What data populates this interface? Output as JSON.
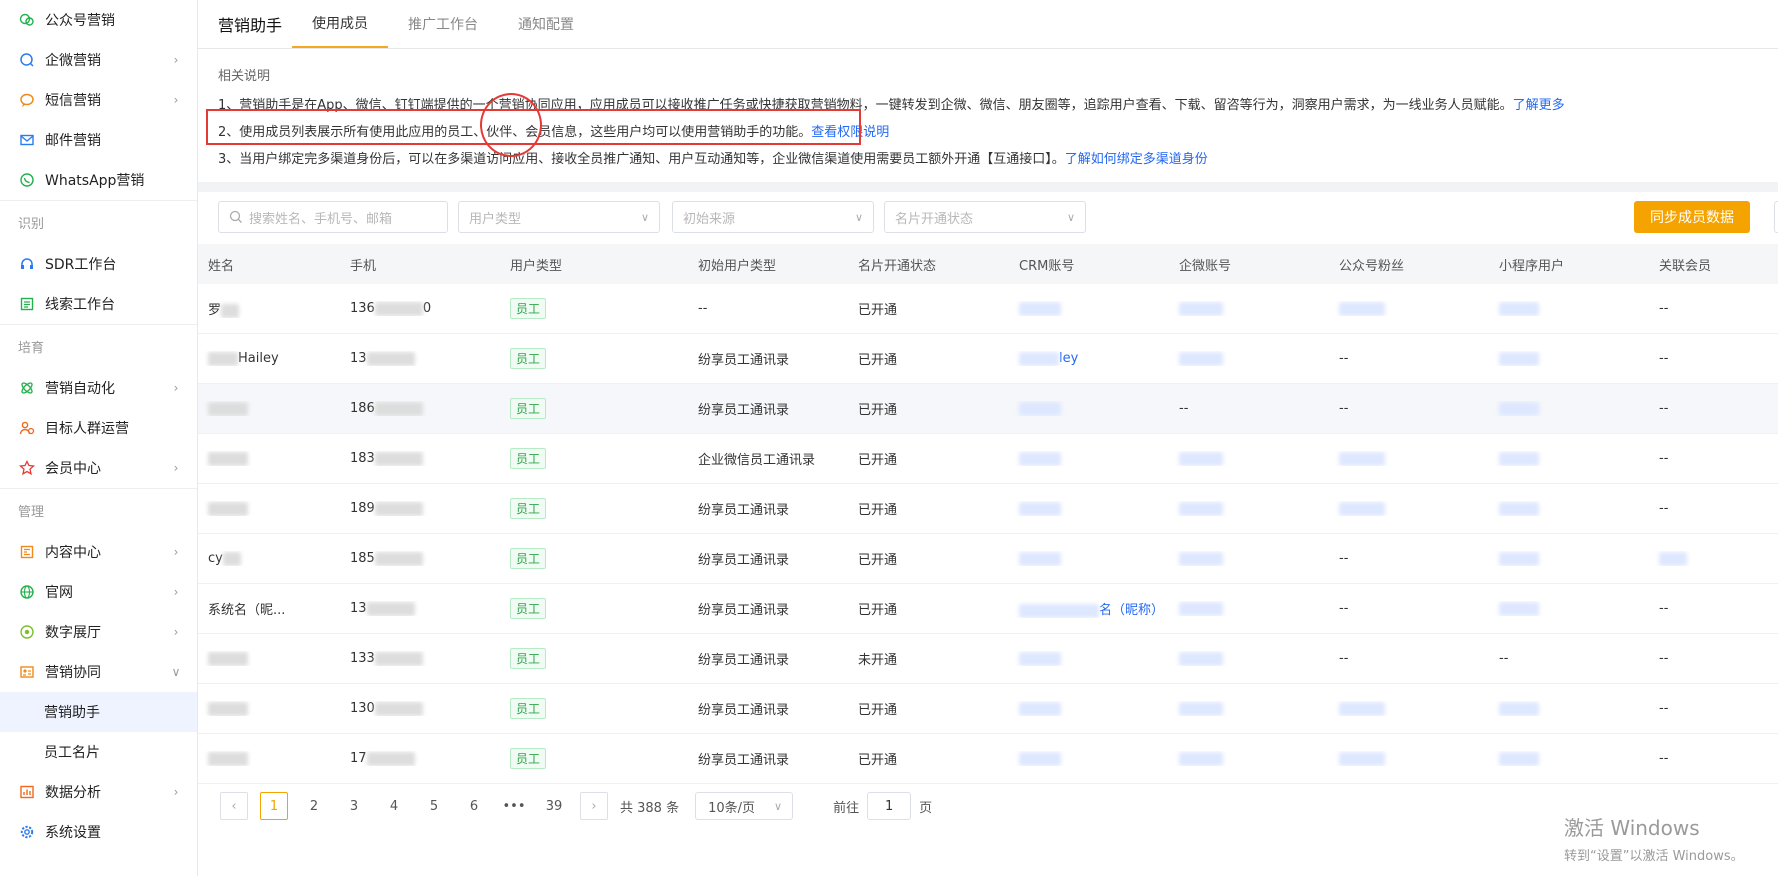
{
  "sidebar": {
    "items_top": [
      {
        "label": "公众号营销",
        "icon": "wechat-official-icon",
        "chev": false
      },
      {
        "label": "企微营销",
        "icon": "wecom-icon",
        "chev": true
      },
      {
        "label": "短信营销",
        "icon": "sms-icon",
        "chev": true
      },
      {
        "label": "邮件营销",
        "icon": "mail-icon",
        "chev": false
      },
      {
        "label": "WhatsApp营销",
        "icon": "whatsapp-icon",
        "chev": false
      }
    ],
    "section_identify": "识别",
    "items_identify": [
      {
        "label": "SDR工作台",
        "icon": "headset-icon",
        "chev": false
      },
      {
        "label": "线索工作台",
        "icon": "leads-icon",
        "chev": false
      }
    ],
    "section_nurture": "培育",
    "items_nurture": [
      {
        "label": "营销自动化",
        "icon": "automation-icon",
        "chev": true
      },
      {
        "label": "目标人群运营",
        "icon": "audience-icon",
        "chev": false
      },
      {
        "label": "会员中心",
        "icon": "member-icon",
        "chev": true
      }
    ],
    "section_manage": "管理",
    "items_manage": [
      {
        "label": "内容中心",
        "icon": "content-icon",
        "chev": true
      },
      {
        "label": "官网",
        "icon": "website-icon",
        "chev": true
      },
      {
        "label": "数字展厅",
        "icon": "showroom-icon",
        "chev": true
      },
      {
        "label": "营销协同",
        "icon": "collab-icon",
        "chev": true
      }
    ],
    "sub_items": [
      "营销助手",
      "员工名片"
    ],
    "items_bottom": [
      {
        "label": "数据分析",
        "icon": "analytics-icon",
        "chev": true
      },
      {
        "label": "系统设置",
        "icon": "settings-icon",
        "chev": false
      }
    ]
  },
  "topbar": {
    "title": "营销助手",
    "tabs": [
      "使用成员",
      "推广工作台",
      "通知配置"
    ]
  },
  "notes": {
    "head": "相关说明",
    "line1": "1、营销助手是在App、微信、钉钉端提供的一个营销协同应用，应用成员可以接收推广任务或快捷获取营销物料，一键转发到企微、微信、朋友圈等，追踪用户查看、下载、留咨等行为，洞察用户需求，为一线业务人员赋能。",
    "line1_link": "了解更多",
    "line2": "2、使用成员列表展示所有使用此应用的员工、伙伴、会员信息，这些用户均可以使用营销助手的功能。",
    "line2_link": "查看权限说明",
    "line3": "3、当用户绑定完多渠道身份后，可以在多渠道访问应用、接收全员推广通知、用户互动通知等，企业微信渠道使用需要员工额外开通【互通接口】。",
    "line3_link": "了解如何绑定多渠道身份"
  },
  "filters": {
    "search_placeholder": "搜索姓名、手机号、邮箱",
    "user_type": "用户类型",
    "source": "初始来源",
    "card_status": "名片开通状态",
    "sync_button": "同步成员数据"
  },
  "table": {
    "headers": [
      "姓名",
      "手机",
      "用户类型",
      "初始用户类型",
      "名片开通状态",
      "CRM账号",
      "企微账号",
      "公众号粉丝",
      "小程序用户",
      "关联会员"
    ],
    "rows": [
      {
        "name": "罗",
        "phone": "136",
        "phone_tail": "0",
        "type": "员工",
        "init": "--",
        "status": "已开通",
        "wecom": "",
        "fans": "",
        "mini": "",
        "member": "--"
      },
      {
        "name": "Hailey",
        "phone": "13",
        "phone_tail": "",
        "type": "员工",
        "init": "纷享员工通讯录",
        "status": "已开通",
        "wecom": "",
        "fans": "--",
        "mini": "",
        "member": "--"
      },
      {
        "name": "",
        "phone": "186",
        "phone_tail": "",
        "type": "员工",
        "init": "纷享员工通讯录",
        "status": "已开通",
        "wecom": "--",
        "fans": "--",
        "mini": "",
        "member": "--"
      },
      {
        "name": "",
        "phone": "183",
        "phone_tail": "",
        "type": "员工",
        "init": "企业微信员工通讯录",
        "status": "已开通",
        "wecom": "",
        "fans": "",
        "mini": "",
        "member": "--"
      },
      {
        "name": "",
        "phone": "189",
        "phone_tail": "",
        "type": "员工",
        "init": "纷享员工通讯录",
        "status": "已开通",
        "wecom": "",
        "fans": "",
        "mini": "",
        "member": "--"
      },
      {
        "name": "cy",
        "phone": "185",
        "phone_tail": "",
        "type": "员工",
        "init": "纷享员工通讯录",
        "status": "已开通",
        "wecom": "",
        "fans": "--",
        "mini": "",
        "member": ""
      },
      {
        "name": "系统名（昵...",
        "phone": "13",
        "phone_tail": "",
        "type": "员工",
        "init": "纷享员工通讯录",
        "status": "已开通",
        "wecom": "",
        "fans": "--",
        "mini": "",
        "member": "--"
      },
      {
        "name": "",
        "phone": "133",
        "phone_tail": "",
        "type": "员工",
        "init": "纷享员工通讯录",
        "status": "未开通",
        "wecom": "",
        "fans": "--",
        "mini": "--",
        "member": "--"
      },
      {
        "name": "",
        "phone": "130",
        "phone_tail": "",
        "type": "员工",
        "init": "纷享员工通讯录",
        "status": "已开通",
        "wecom": "",
        "fans": "",
        "mini": "",
        "member": "--"
      },
      {
        "name": "",
        "phone": "17",
        "phone_tail": "",
        "type": "员工",
        "init": "纷享员工通讯录",
        "status": "已开通",
        "wecom": "",
        "fans": "",
        "mini": "",
        "member": "--"
      }
    ],
    "crm_row2_text": "ley",
    "crm_row7_text": "名（昵称）"
  },
  "pager": {
    "pages": [
      "1",
      "2",
      "3",
      "4",
      "5",
      "6",
      "•••",
      "39"
    ],
    "total": "共 388 条",
    "page_size": "10条/页",
    "goto_prefix": "前往",
    "goto_value": "1",
    "goto_suffix": "页"
  },
  "watermark": {
    "line1": "激活 Windows",
    "line2": "转到“设置”以激活 Windows。"
  },
  "colors": {
    "accent": "#f5a300",
    "link": "#2468f2",
    "highlight": "#e53935"
  }
}
